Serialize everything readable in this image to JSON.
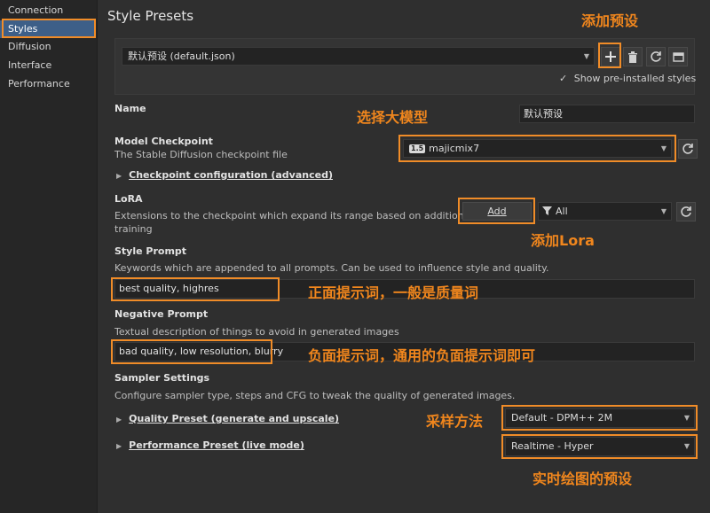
{
  "sidebar": {
    "items": [
      {
        "label": "Connection"
      },
      {
        "label": "Styles"
      },
      {
        "label": "Diffusion"
      },
      {
        "label": "Interface"
      },
      {
        "label": "Performance"
      }
    ]
  },
  "page": {
    "title": "Style Presets"
  },
  "preset": {
    "selected": "默认预设 (default.json)",
    "show_preinstalled_label": "Show pre-installed styles",
    "show_preinstalled_checked": true,
    "checkmark": "✓"
  },
  "name": {
    "label": "Name",
    "value": "默认预设"
  },
  "checkpoint": {
    "label": "Model Checkpoint",
    "desc": "The Stable Diffusion checkpoint file",
    "badge": "1.5",
    "value": "majicmix7",
    "config_label": "Checkpoint configuration (advanced)"
  },
  "lora": {
    "label": "LoRA",
    "desc_line1": "Extensions to the checkpoint which expand its range based on additional",
    "desc_line2": "training",
    "add_label": "Add",
    "filter_value": "All"
  },
  "style_prompt": {
    "label": "Style Prompt",
    "desc": "Keywords which are appended to all prompts. Can be used to influence style and quality.",
    "value": "best quality, highres"
  },
  "negative_prompt": {
    "label": "Negative Prompt",
    "desc": "Textual description of things to avoid in generated images",
    "value": "bad quality, low resolution, blurry"
  },
  "sampler": {
    "label": "Sampler Settings",
    "desc": "Configure sampler type, steps and CFG to tweak the quality of generated images.",
    "quality_label": "Quality Preset (generate and upscale)",
    "quality_value": "Default - DPM++ 2M",
    "performance_label": "Performance Preset (live mode)",
    "performance_value": "Realtime - Hyper"
  },
  "annotations": {
    "add_preset": "添加预设",
    "select_model": "选择大模型",
    "add_lora": "添加Lora",
    "positive": "正面提示词，一般是质量词",
    "negative": "负面提示词，通用的负面提示词即可",
    "sampler": "采样方法",
    "realtime": "实时绘图的预设"
  },
  "colors": {
    "accent": "#f08c28",
    "selected": "#3d5f88"
  }
}
